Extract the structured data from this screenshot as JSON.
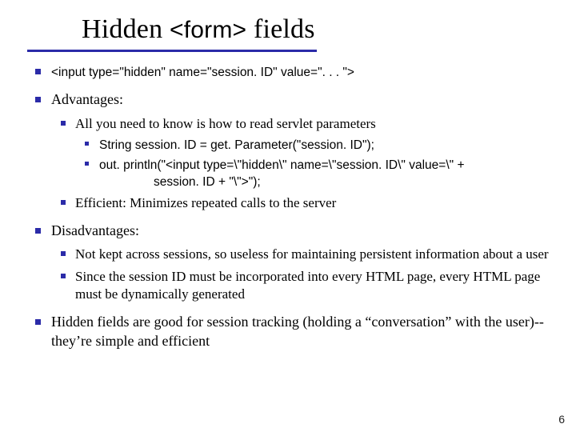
{
  "title_pre": "Hidden ",
  "title_form": "<form>",
  "title_post": " fields",
  "bullets": {
    "input_line": "<input type=\"hidden\" name=\"session. ID\" value=\". . . \">",
    "adv_label": "Advantages:",
    "adv_item1": "All you need to know is how to read servlet parameters",
    "adv_code1": "String session. ID = get. Parameter(\"session. ID\");",
    "adv_code2a": "out. println(\"<input type=\\\"hidden\\\" name=\\\"session. ID\\\" value=\\\" +",
    "adv_code2b": "session. ID + \"\\\">\");",
    "adv_item2": "Efficient: Minimizes repeated calls to the server",
    "dis_label": "Disadvantages:",
    "dis_item1": "Not kept across sessions, so useless for maintaining persistent information about a user",
    "dis_item2": "Since the session ID must be incorporated into every HTML page, every HTML page must be dynamically generated",
    "closing": "Hidden fields are good for session tracking (holding a “conversation” with the user)--they’re simple and efficient"
  },
  "page_number": "6"
}
